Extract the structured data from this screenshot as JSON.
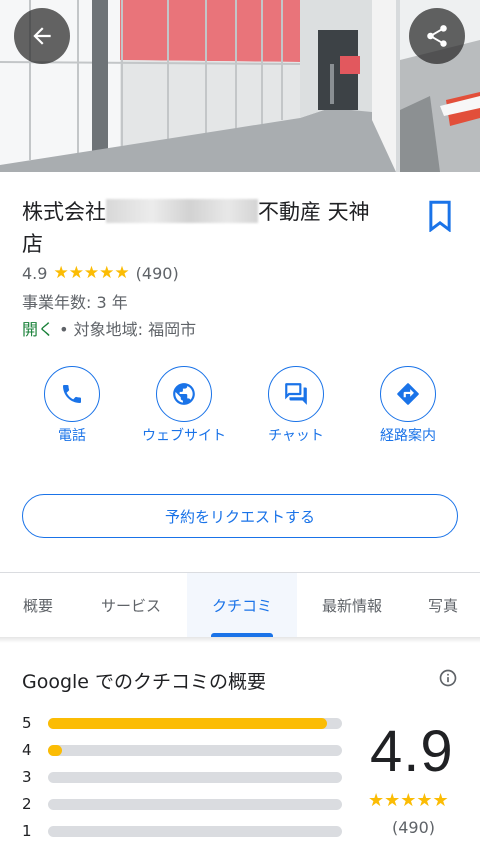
{
  "header": {
    "back_icon": "arrow-back-icon",
    "share_icon": "share-icon"
  },
  "place": {
    "name_prefix": "株式会社",
    "name_suffix": "不動産 天神",
    "name_line2": "店",
    "rating": "4.9",
    "stars": "★★★★★",
    "review_count": "(490)",
    "years_in_business": "事業年数: 3 年",
    "open_status": "開く",
    "service_area": " • 対象地域: 福岡市"
  },
  "actions": [
    {
      "label": "電話",
      "icon": "phone-icon"
    },
    {
      "label": "ウェブサイト",
      "icon": "globe-icon"
    },
    {
      "label": "チャット",
      "icon": "chat-icon"
    },
    {
      "label": "経路案内",
      "icon": "directions-icon"
    }
  ],
  "reserve_button": "予約をリクエストする",
  "tabs": [
    {
      "label": "概要"
    },
    {
      "label": "サービス"
    },
    {
      "label": "クチコミ",
      "active": true
    },
    {
      "label": "最新情報"
    },
    {
      "label": "写真"
    }
  ],
  "reviews": {
    "title": "Google でのクチコミの概要",
    "score": "4.9",
    "stars": "★★★★★",
    "count": "(490)",
    "distribution": [
      {
        "stars": "5",
        "fraction": 0.95
      },
      {
        "stars": "4",
        "fraction": 0.05
      },
      {
        "stars": "3",
        "fraction": 0
      },
      {
        "stars": "2",
        "fraction": 0
      },
      {
        "stars": "1",
        "fraction": 0
      }
    ]
  },
  "colors": {
    "accent": "#1a73e8",
    "star": "#fbbc04",
    "open": "#188038"
  }
}
